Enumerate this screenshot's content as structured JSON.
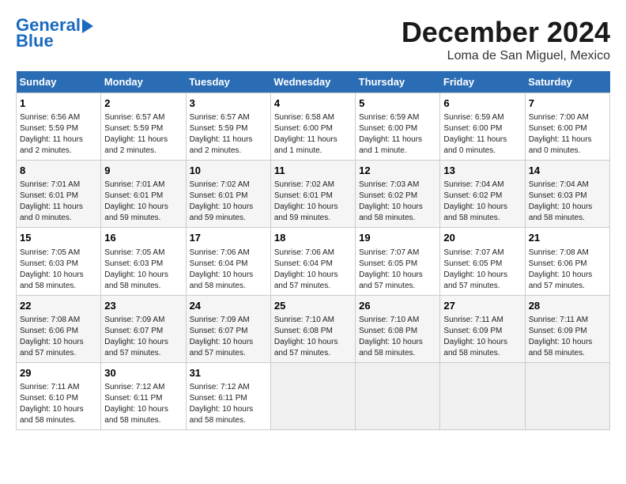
{
  "header": {
    "logo_line1": "General",
    "logo_line2": "Blue",
    "month_title": "December 2024",
    "location": "Loma de San Miguel, Mexico"
  },
  "days_of_week": [
    "Sunday",
    "Monday",
    "Tuesday",
    "Wednesday",
    "Thursday",
    "Friday",
    "Saturday"
  ],
  "weeks": [
    [
      {
        "num": "1",
        "info": "Sunrise: 6:56 AM\nSunset: 5:59 PM\nDaylight: 11 hours and 2 minutes."
      },
      {
        "num": "2",
        "info": "Sunrise: 6:57 AM\nSunset: 5:59 PM\nDaylight: 11 hours and 2 minutes."
      },
      {
        "num": "3",
        "info": "Sunrise: 6:57 AM\nSunset: 5:59 PM\nDaylight: 11 hours and 2 minutes."
      },
      {
        "num": "4",
        "info": "Sunrise: 6:58 AM\nSunset: 6:00 PM\nDaylight: 11 hours and 1 minute."
      },
      {
        "num": "5",
        "info": "Sunrise: 6:59 AM\nSunset: 6:00 PM\nDaylight: 11 hours and 1 minute."
      },
      {
        "num": "6",
        "info": "Sunrise: 6:59 AM\nSunset: 6:00 PM\nDaylight: 11 hours and 0 minutes."
      },
      {
        "num": "7",
        "info": "Sunrise: 7:00 AM\nSunset: 6:00 PM\nDaylight: 11 hours and 0 minutes."
      }
    ],
    [
      {
        "num": "8",
        "info": "Sunrise: 7:01 AM\nSunset: 6:01 PM\nDaylight: 11 hours and 0 minutes."
      },
      {
        "num": "9",
        "info": "Sunrise: 7:01 AM\nSunset: 6:01 PM\nDaylight: 10 hours and 59 minutes."
      },
      {
        "num": "10",
        "info": "Sunrise: 7:02 AM\nSunset: 6:01 PM\nDaylight: 10 hours and 59 minutes."
      },
      {
        "num": "11",
        "info": "Sunrise: 7:02 AM\nSunset: 6:01 PM\nDaylight: 10 hours and 59 minutes."
      },
      {
        "num": "12",
        "info": "Sunrise: 7:03 AM\nSunset: 6:02 PM\nDaylight: 10 hours and 58 minutes."
      },
      {
        "num": "13",
        "info": "Sunrise: 7:04 AM\nSunset: 6:02 PM\nDaylight: 10 hours and 58 minutes."
      },
      {
        "num": "14",
        "info": "Sunrise: 7:04 AM\nSunset: 6:03 PM\nDaylight: 10 hours and 58 minutes."
      }
    ],
    [
      {
        "num": "15",
        "info": "Sunrise: 7:05 AM\nSunset: 6:03 PM\nDaylight: 10 hours and 58 minutes."
      },
      {
        "num": "16",
        "info": "Sunrise: 7:05 AM\nSunset: 6:03 PM\nDaylight: 10 hours and 58 minutes."
      },
      {
        "num": "17",
        "info": "Sunrise: 7:06 AM\nSunset: 6:04 PM\nDaylight: 10 hours and 58 minutes."
      },
      {
        "num": "18",
        "info": "Sunrise: 7:06 AM\nSunset: 6:04 PM\nDaylight: 10 hours and 57 minutes."
      },
      {
        "num": "19",
        "info": "Sunrise: 7:07 AM\nSunset: 6:05 PM\nDaylight: 10 hours and 57 minutes."
      },
      {
        "num": "20",
        "info": "Sunrise: 7:07 AM\nSunset: 6:05 PM\nDaylight: 10 hours and 57 minutes."
      },
      {
        "num": "21",
        "info": "Sunrise: 7:08 AM\nSunset: 6:06 PM\nDaylight: 10 hours and 57 minutes."
      }
    ],
    [
      {
        "num": "22",
        "info": "Sunrise: 7:08 AM\nSunset: 6:06 PM\nDaylight: 10 hours and 57 minutes."
      },
      {
        "num": "23",
        "info": "Sunrise: 7:09 AM\nSunset: 6:07 PM\nDaylight: 10 hours and 57 minutes."
      },
      {
        "num": "24",
        "info": "Sunrise: 7:09 AM\nSunset: 6:07 PM\nDaylight: 10 hours and 57 minutes."
      },
      {
        "num": "25",
        "info": "Sunrise: 7:10 AM\nSunset: 6:08 PM\nDaylight: 10 hours and 57 minutes."
      },
      {
        "num": "26",
        "info": "Sunrise: 7:10 AM\nSunset: 6:08 PM\nDaylight: 10 hours and 58 minutes."
      },
      {
        "num": "27",
        "info": "Sunrise: 7:11 AM\nSunset: 6:09 PM\nDaylight: 10 hours and 58 minutes."
      },
      {
        "num": "28",
        "info": "Sunrise: 7:11 AM\nSunset: 6:09 PM\nDaylight: 10 hours and 58 minutes."
      }
    ],
    [
      {
        "num": "29",
        "info": "Sunrise: 7:11 AM\nSunset: 6:10 PM\nDaylight: 10 hours and 58 minutes."
      },
      {
        "num": "30",
        "info": "Sunrise: 7:12 AM\nSunset: 6:11 PM\nDaylight: 10 hours and 58 minutes."
      },
      {
        "num": "31",
        "info": "Sunrise: 7:12 AM\nSunset: 6:11 PM\nDaylight: 10 hours and 58 minutes."
      },
      {
        "num": "",
        "info": ""
      },
      {
        "num": "",
        "info": ""
      },
      {
        "num": "",
        "info": ""
      },
      {
        "num": "",
        "info": ""
      }
    ]
  ]
}
